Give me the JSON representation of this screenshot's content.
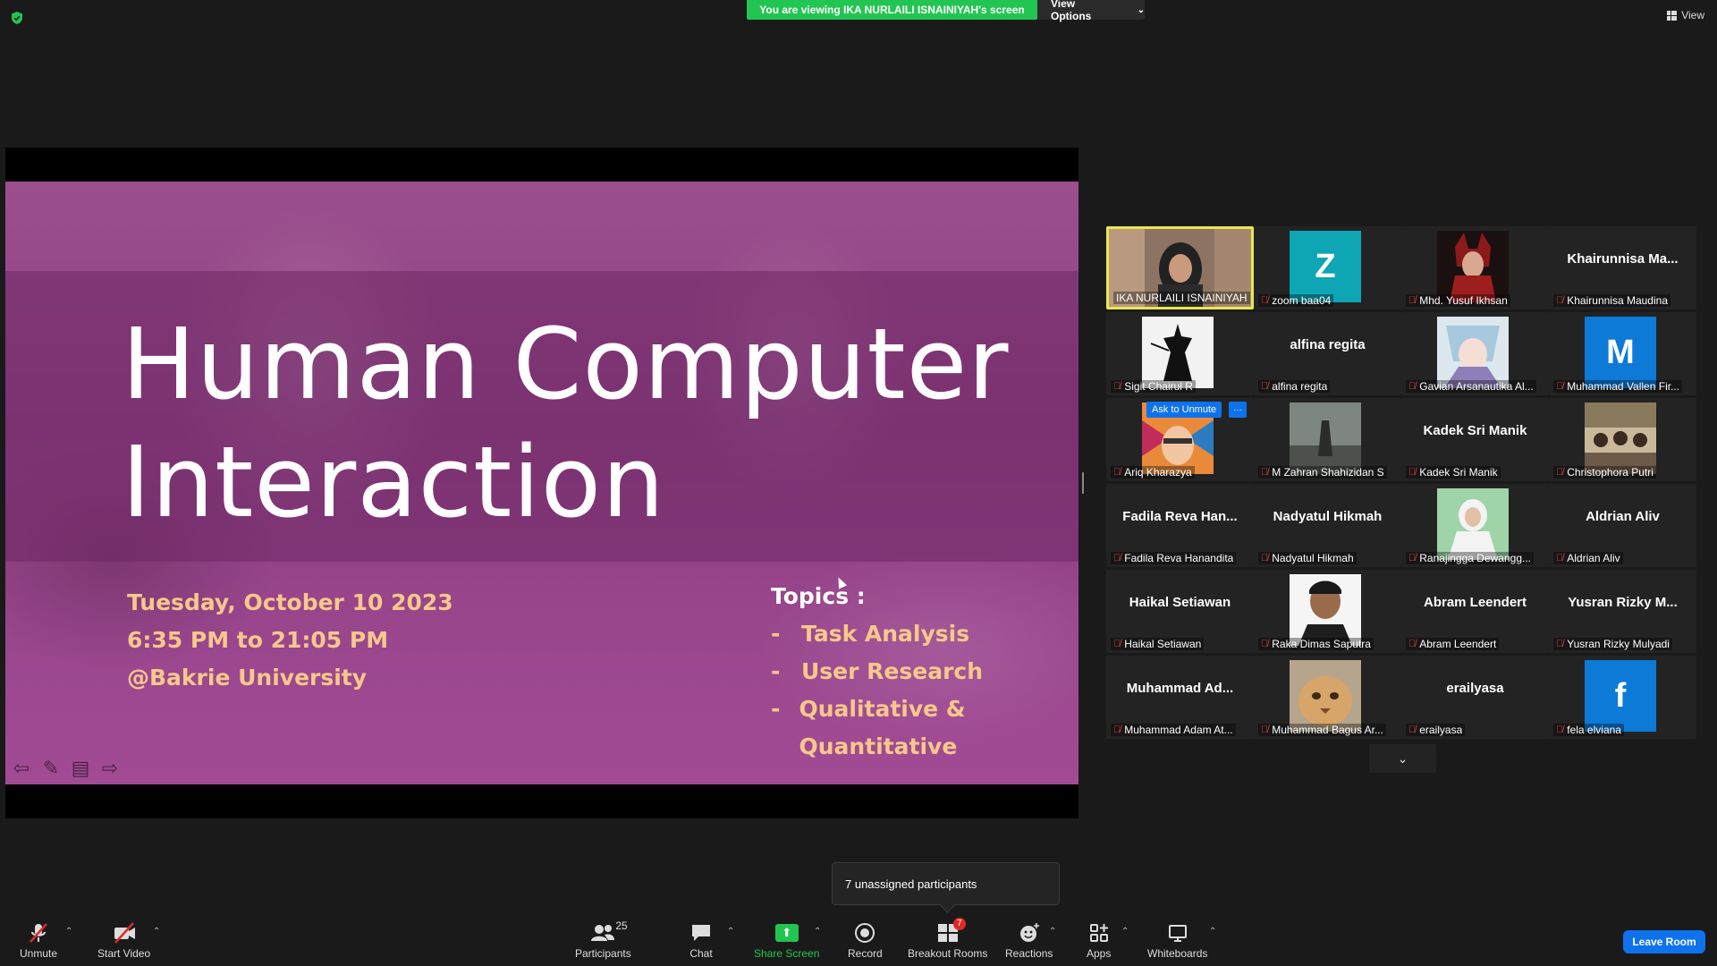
{
  "topbar": {
    "viewing_banner": "You are viewing IKA NURLAILI ISNAINIYAH's screen",
    "view_options": "View Options",
    "view_label": "View"
  },
  "slide": {
    "title_line1": "Human Computer",
    "title_line2": "Interaction",
    "date": "Tuesday, October 10 2023",
    "time": "6:35 PM to 21:05 PM",
    "location": "@Bakrie University",
    "topics_heading": "Topics :",
    "topics": [
      "Task Analysis",
      "User Research",
      "Qualitative & Quantitative"
    ],
    "dash": "-"
  },
  "gallery": {
    "tiles": [
      {
        "name": "IKA NURLAILI ISNAINIYAH"
      },
      {
        "name": "zoom baa04",
        "avatar": "Z"
      },
      {
        "name": "Mhd. Yusuf Ikhsan"
      },
      {
        "name": "Khairunnisa Maudina",
        "display": "Khairunnisa  Ma..."
      },
      {
        "name": "Sigit Chairul R"
      },
      {
        "name": "alfina regita",
        "display": "alfina regita"
      },
      {
        "name": "Gavian Arsanautika Al..."
      },
      {
        "name": "Muhammad Vallen Fir...",
        "avatar": "M"
      },
      {
        "name": "Ariq Kharazya"
      },
      {
        "name": "M Zahran Shahizidan S"
      },
      {
        "name": "Kadek Sri Manik",
        "display": "Kadek Sri Manik"
      },
      {
        "name": "Christophora Putri"
      },
      {
        "name": "Fadila Reva Hanandita",
        "display": "Fadila Reva Han..."
      },
      {
        "name": "Nadyatul Hikmah",
        "display": "Nadyatul Hikmah"
      },
      {
        "name": "Ranajingga Dewangg..."
      },
      {
        "name": "Aldrian Aliv",
        "display": "Aldrian Aliv"
      },
      {
        "name": "Haikal Setiawan",
        "display": "Haikal Setiawan"
      },
      {
        "name": "Raka Dimas Saputra"
      },
      {
        "name": "Abram Leendert",
        "display": "Abram Leendert"
      },
      {
        "name": "Yusran Rizky Mulyadi",
        "display": "Yusran Rizky  M..."
      },
      {
        "name": "Muhammad Adam At...",
        "display": "Muhammad  Ad..."
      },
      {
        "name": "Muhammad Bagus Ar..."
      },
      {
        "name": "erailyasa",
        "display": "erailyasa"
      },
      {
        "name": "fela elviana",
        "avatar": "f"
      }
    ],
    "ask_to_unmute": "Ask to Unmute",
    "more": "···"
  },
  "tooltip": {
    "unassigned": "7 unassigned participants"
  },
  "toolbar": {
    "unmute": "Unmute",
    "start_video": "Start Video",
    "participants": "Participants",
    "participants_count": "25",
    "chat": "Chat",
    "share_screen": "Share Screen",
    "record": "Record",
    "breakout_rooms": "Breakout Rooms",
    "breakout_badge": "7",
    "reactions": "Reactions",
    "apps": "Apps",
    "whiteboards": "Whiteboards",
    "leave_room": "Leave Room"
  },
  "colors": {
    "banner_green": "#23c552",
    "active_speaker": "#e9e74d",
    "zoom_blue": "#0e72ed",
    "avatar_teal": "#0ea5b5",
    "avatar_blue": "#0c7ad6",
    "slide_accent": "#f7c88b"
  }
}
